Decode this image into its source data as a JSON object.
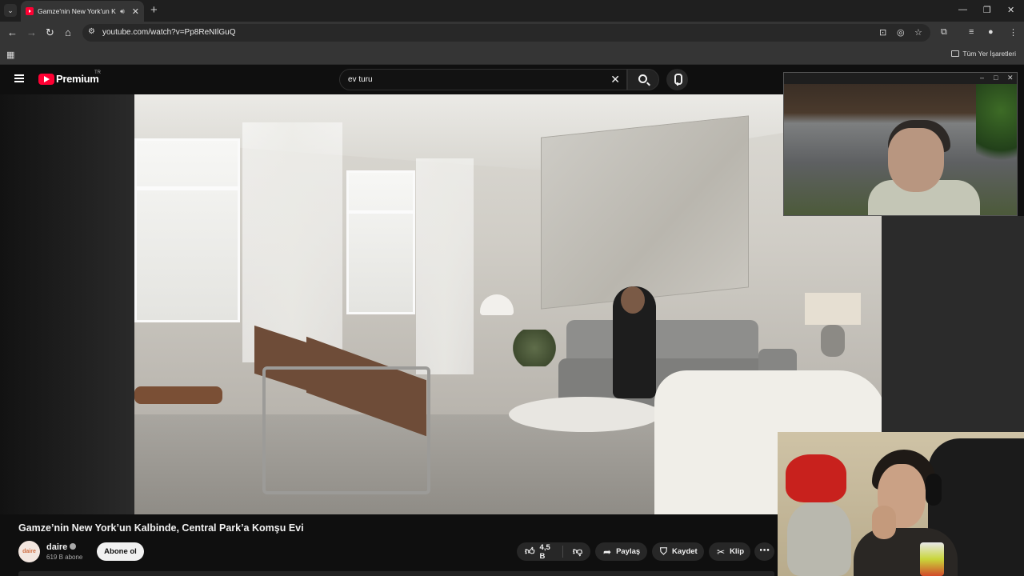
{
  "browser": {
    "tab_title": "Gamze'nin New York'un Kalbinde, Central Park'a Komşu Evi",
    "url": "youtube.com/watch?v=Pp8ReNIlGuQ",
    "bookmarks_all": "Tüm Yer İşaretleri"
  },
  "youtube": {
    "brand": "Premium",
    "country": "TR",
    "search_query": "ev turu"
  },
  "video": {
    "title": "Gamze’nin New York’un Kalbinde, Central Park’a Komşu Evi",
    "channel": {
      "name": "daire",
      "avatar_text": "daire",
      "subscribers": "619 B abone",
      "subscribe_label": "Abone ol"
    },
    "actions": {
      "likes": "4,5 B",
      "share": "Paylaş",
      "save": "Kaydet",
      "clip": "Klip"
    }
  },
  "icons": {
    "tab_search": "chevron-down-icon",
    "favicon": "youtube-icon",
    "audio": "speaker-icon",
    "back": "arrow-left-icon",
    "forward": "arrow-right-icon",
    "reload": "reload-icon",
    "home": "home-icon",
    "menu": "hamburger-icon",
    "search": "search-icon",
    "mic": "microphone-icon",
    "like": "thumbs-up-icon",
    "dislike": "thumbs-down-icon",
    "share": "share-arrow-icon",
    "save": "bookmark-icon",
    "clip": "scissors-icon",
    "more": "more-horizontal-icon"
  },
  "colors": {
    "accent": "#ff0033",
    "background": "#0f0f0f",
    "pill": "#272727"
  }
}
